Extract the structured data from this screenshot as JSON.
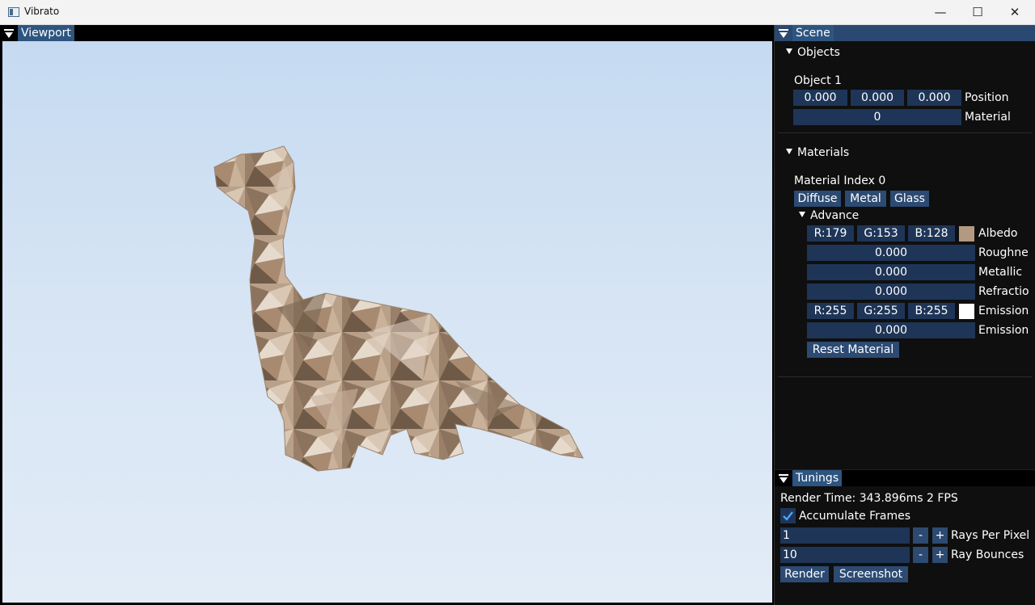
{
  "window": {
    "title": "Vibrato",
    "min_glyph": "—",
    "max_glyph": "☐",
    "close_glyph": "✕"
  },
  "viewport": {
    "title": "Viewport"
  },
  "scene": {
    "title": "Scene",
    "objects": {
      "header": "Objects",
      "object_name": "Object 1",
      "position": [
        "0.000",
        "0.000",
        "0.000"
      ],
      "position_label": "Position",
      "material": "0",
      "material_label": "Material"
    },
    "materials": {
      "header": "Materials",
      "index_label": "Material Index 0",
      "types": [
        "Diffuse",
        "Metal",
        "Glass"
      ],
      "advance_header": "Advance",
      "albedo": {
        "r": "R:179",
        "g": "G:153",
        "b": "B:128",
        "color": "#b39980",
        "label": "Albedo"
      },
      "roughness": {
        "value": "0.000",
        "label": "Roughne"
      },
      "metallic": {
        "value": "0.000",
        "label": "Metallic"
      },
      "refraction": {
        "value": "0.000",
        "label": "Refractio"
      },
      "emission_color": {
        "r": "R:255",
        "g": "G:255",
        "b": "B:255",
        "color": "#ffffff",
        "label": "Emission"
      },
      "emission_strength": {
        "value": "0.000",
        "label": "Emission"
      },
      "reset_label": "Reset Material"
    }
  },
  "tunings": {
    "title": "Tunings",
    "render_time": "Render Time: 343.896ms  2 FPS",
    "accumulate_label": "Accumulate Frames",
    "accumulate_checked": true,
    "rays_per_pixel": {
      "value": "1",
      "label": "Rays Per Pixel",
      "minus": "-",
      "plus": "+"
    },
    "ray_bounces": {
      "value": "10",
      "label": "Ray Bounces",
      "minus": "-",
      "plus": "+"
    },
    "render_label": "Render",
    "screenshot_label": "Screenshot"
  },
  "colors": {
    "accent": "#2e5580",
    "field_bg": "#1e3557",
    "panel_bg": "#0f0f0f",
    "sky_top": "#c5daf1",
    "model": "#b39980"
  }
}
